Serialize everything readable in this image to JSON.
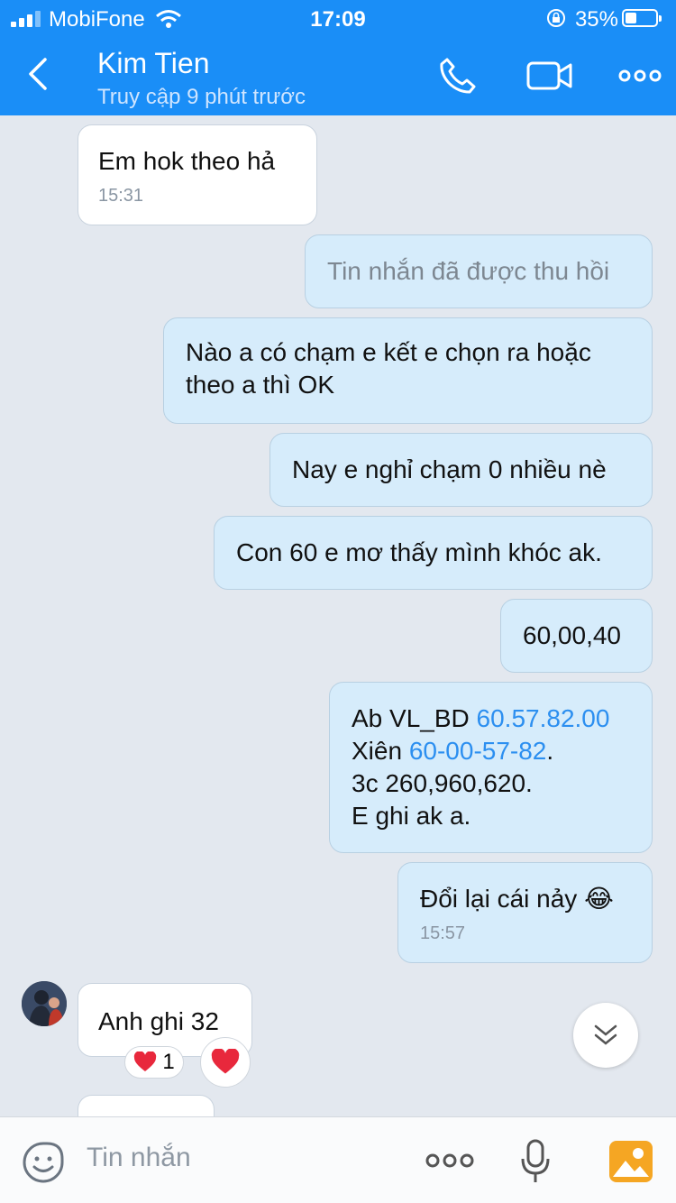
{
  "status": {
    "carrier": "MobiFone",
    "time": "17:09",
    "battery": "35%"
  },
  "header": {
    "title": "Kim Tien",
    "subtitle": "Truy cập 9 phút trước"
  },
  "messages": {
    "m1": {
      "text": "Em hok theo hả",
      "time": "15:31"
    },
    "m2": {
      "text": "Tin nhắn đã được thu hồi"
    },
    "m3": {
      "line1": "Nào a có chạm e kết e chọn ra hoặc",
      "line2": "theo a thì OK"
    },
    "m4": {
      "text": "Nay e nghỉ chạm 0 nhiều nè"
    },
    "m5": {
      "text": "Con 60 e mơ thấy mình khóc ak."
    },
    "m6": {
      "text": "60,00,40"
    },
    "m7": {
      "l1_prefix": "Ab VL_BD ",
      "l1_link": "60.57.82.00",
      "l2_prefix": "Xiên ",
      "l2_link": "60-00-57-82",
      "l2_suffix": ".",
      "l3": "3c 260,960,620.",
      "l4": "E ghi ak a."
    },
    "m8": {
      "text": "Đổi lại cái nảy 😂",
      "time": "15:57"
    },
    "m9": {
      "text": "Anh ghi 32",
      "reaction_count": "1"
    }
  },
  "composer": {
    "placeholder": "Tin nhắn"
  },
  "colors": {
    "header": "#1a8ef7",
    "outgoing": "#d6ecfb",
    "incoming": "#ffffff",
    "link": "#2c8ff0",
    "background": "#e3e8ef"
  }
}
